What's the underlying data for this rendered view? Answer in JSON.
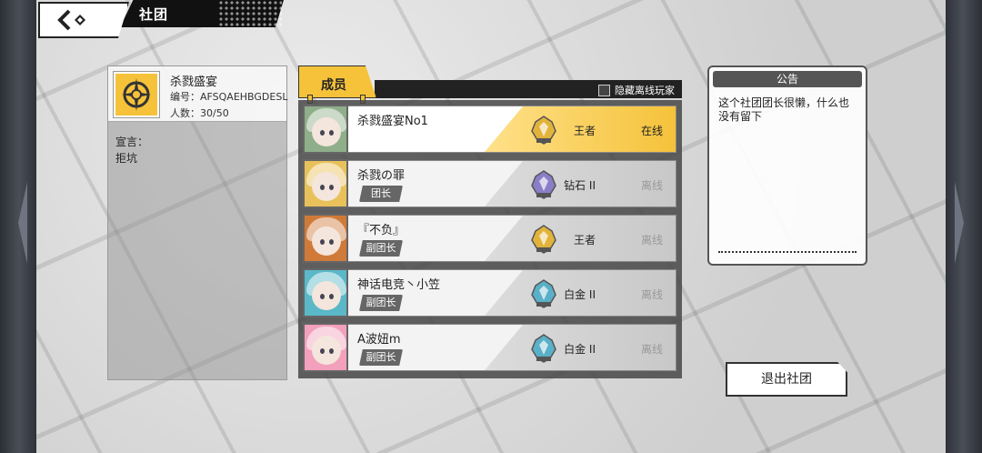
{
  "header": {
    "title": "社团"
  },
  "guild": {
    "name": "杀戮盛宴",
    "id_text": "编号：AFSQAEHBGDESL",
    "count_text": "人数：30/50",
    "declaration_label": "宣言：",
    "declaration": "拒坑"
  },
  "members_tab": {
    "label": "成员",
    "hide_offline": "隐藏离线玩家"
  },
  "members": [
    {
      "name": "杀戮盛宴No1",
      "role": "",
      "rank": "王者",
      "status": "在线",
      "avatar_color": "#8fae8a",
      "rank_color": "#e2b33a",
      "selected": true
    },
    {
      "name": "杀戮の罪",
      "role": "团长",
      "rank": "钻石 II",
      "status": "离线",
      "avatar_color": "#e8c15a",
      "rank_color": "#8a7ec8",
      "selected": false
    },
    {
      "name": "『不负』",
      "role": "副团长",
      "rank": "王者",
      "status": "离线",
      "avatar_color": "#d07a3a",
      "rank_color": "#e2b33a",
      "selected": false
    },
    {
      "name": "神话电竞丶小笠",
      "role": "副团长",
      "rank": "白金 II",
      "status": "离线",
      "avatar_color": "#5ab8c8",
      "rank_color": "#5ab0c8",
      "selected": false
    },
    {
      "name": "A波妞m",
      "role": "副团长",
      "rank": "白金 II",
      "status": "离线",
      "avatar_color": "#f2a0bc",
      "rank_color": "#5ab0c8",
      "selected": false
    }
  ],
  "notice": {
    "title": "公告",
    "text": "这个社团团长很懒，什么也没有留下"
  },
  "quit_button": "退出社团",
  "colors": {
    "accent": "#f5c23a",
    "dark": "#222222"
  }
}
